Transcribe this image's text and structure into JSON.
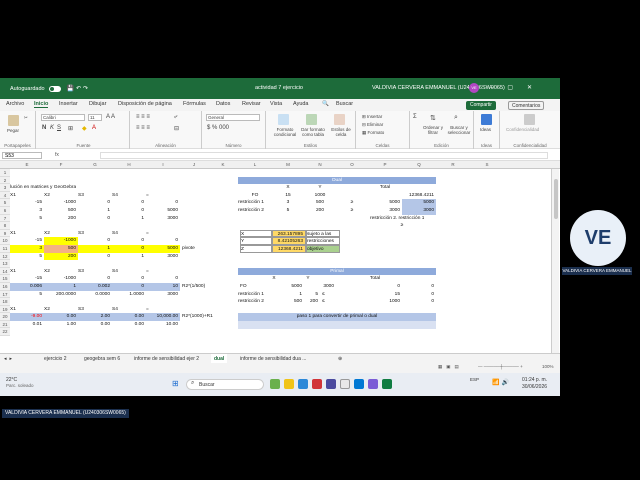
{
  "titlebar": {
    "autosave": "Autoguardado",
    "document": "actividad 7 ejercicio",
    "user": "VALDIVIA CERVERA EMMANUEL (U240306SW0065)",
    "avatar": "VE"
  },
  "menu": {
    "items": [
      "Archivo",
      "Inicio",
      "Insertar",
      "Dibujar",
      "Disposición de página",
      "Fórmulas",
      "Datos",
      "Revisar",
      "Vista",
      "Ayuda",
      "Buscar"
    ],
    "share": "Compartir",
    "comments": "Comentarios"
  },
  "ribbon": {
    "groups": [
      "Portapapeles",
      "Fuente",
      "Alineación",
      "Número",
      "Estilos",
      "Celdas",
      "Edición",
      "Ideas",
      "Confidencialidad"
    ],
    "paste": "Pegar",
    "font_name": "Calibri",
    "font_size": "11",
    "number_format": "General",
    "formato_condicional": "Formato condicional",
    "dar_formato_tabla": "Dar formato como tabla",
    "estilos_celda": "Estilos de celda",
    "insertar": "Insertar",
    "eliminar": "Eliminar",
    "formato": "Formato",
    "ordenar": "Ordenar y filtrar",
    "buscar_sel": "Buscar y seleccionar",
    "ideas": "Ideas",
    "confidencialidad": "Confidencialidad"
  },
  "formula_bar": {
    "name_box": "S53",
    "fx": "fx",
    "content": ""
  },
  "columns": [
    "E",
    "F",
    "G",
    "H",
    "I",
    "J",
    "K",
    "L",
    "M",
    "N",
    "O",
    "P",
    "Q",
    "R",
    "S"
  ],
  "rows": [
    "1",
    "2",
    "3",
    "4",
    "5",
    "6",
    "7",
    "8",
    "9",
    "10",
    "11",
    "12",
    "13",
    "14",
    "15",
    "16",
    "17",
    "18",
    "19",
    "20",
    "21",
    "22"
  ],
  "cells": {
    "a3": "lución en matrices y GeoGebra",
    "r4": [
      "X1",
      "X2",
      "S3",
      "S4",
      "="
    ],
    "r5": [
      "-15",
      "-1000",
      "0",
      "0",
      "0"
    ],
    "r6": [
      "3",
      "500",
      "1",
      "0",
      "5000"
    ],
    "r7": [
      "5",
      "200",
      "0",
      "1",
      "3000"
    ],
    "r9": [
      "X1",
      "X2",
      "S3",
      "S4",
      "="
    ],
    "r10": [
      "-15",
      "-1000",
      "0",
      "0",
      "0"
    ],
    "r11": [
      "3",
      "500",
      "1",
      "0",
      "5000"
    ],
    "r12": [
      "5",
      "200",
      "0",
      "1",
      "3000"
    ],
    "pivote": "pivote",
    "r14": [
      "X1",
      "X2",
      "S3",
      "S4",
      "="
    ],
    "r15": [
      "-15",
      "-1000",
      "0",
      "0",
      "0"
    ],
    "r16": [
      "0.006",
      "1",
      "0.002",
      "0",
      "10"
    ],
    "r16_note": "R2*(1/500)",
    "r17": [
      "5",
      "200.0000",
      "0.0000",
      "1.0000",
      "3000"
    ],
    "r19": [
      "X1",
      "X2",
      "S3",
      "S4",
      "="
    ],
    "r20": [
      "-9.00",
      "0.00",
      "2.00",
      "0.00",
      "10,000.00"
    ],
    "r20_note": "R2*(1000)+R1",
    "r21": [
      "0.01",
      "1.00",
      "0.00",
      "0.00",
      "10.00"
    ]
  },
  "dual": {
    "title": "Dual",
    "head": [
      "X",
      "Y",
      "Total"
    ],
    "fo": [
      "FO",
      "15",
      "1000",
      "12368.4211"
    ],
    "r1": [
      "restricción 1",
      "3",
      "500",
      "≥",
      "5000",
      "5000"
    ],
    "r2": [
      "restricción 2",
      "5",
      "200",
      "≥",
      "3000",
      "3000"
    ],
    "extra": "restricción 2. restricción 1",
    "extra2": "≥",
    "sol": [
      [
        "X",
        "263.157895",
        "sujeto a las"
      ],
      [
        "Y",
        "8.42105263",
        "restricciones"
      ],
      [
        "Z",
        "12368.4211",
        "objetivo"
      ]
    ]
  },
  "primal": {
    "title": "Primal",
    "head": [
      "X",
      "Y",
      "Total"
    ],
    "fo": [
      "FO",
      "5000",
      "3000",
      "0",
      "0"
    ],
    "r1": [
      "restricción 1",
      "1",
      "5",
      "≤",
      "15",
      "0"
    ],
    "r2": [
      "restricción 2",
      "500",
      "200",
      "≤",
      "1000",
      "0"
    ],
    "paso": "paso 1 para convertir de primal o dual"
  },
  "sheets": [
    "ejercicio 2",
    "geogebra sem 6",
    "informe de sensibilidad ejer 2",
    "dual",
    "informe de sensibilidad dua ..."
  ],
  "status": {
    "zoom": "100%"
  },
  "taskbar": {
    "temp": "22°C",
    "weather": "Parc. soleado",
    "search": "Buscar",
    "time": "01:24 p. m.",
    "date": "30/06/2026",
    "lang": "ESP"
  },
  "participant": {
    "avatar": "VE",
    "name": "VALDIVIA CERVERA EMMANUEL",
    "bottom_name": "VALDIVIA CERVERA EMMANUEL (U240306SW0065)"
  },
  "colors": {
    "excel_green": "#1d6b3a",
    "header_blue": "#b4c6e7",
    "yellow": "#ffff00",
    "orange": "#f4b183",
    "red": "#ff0000"
  }
}
